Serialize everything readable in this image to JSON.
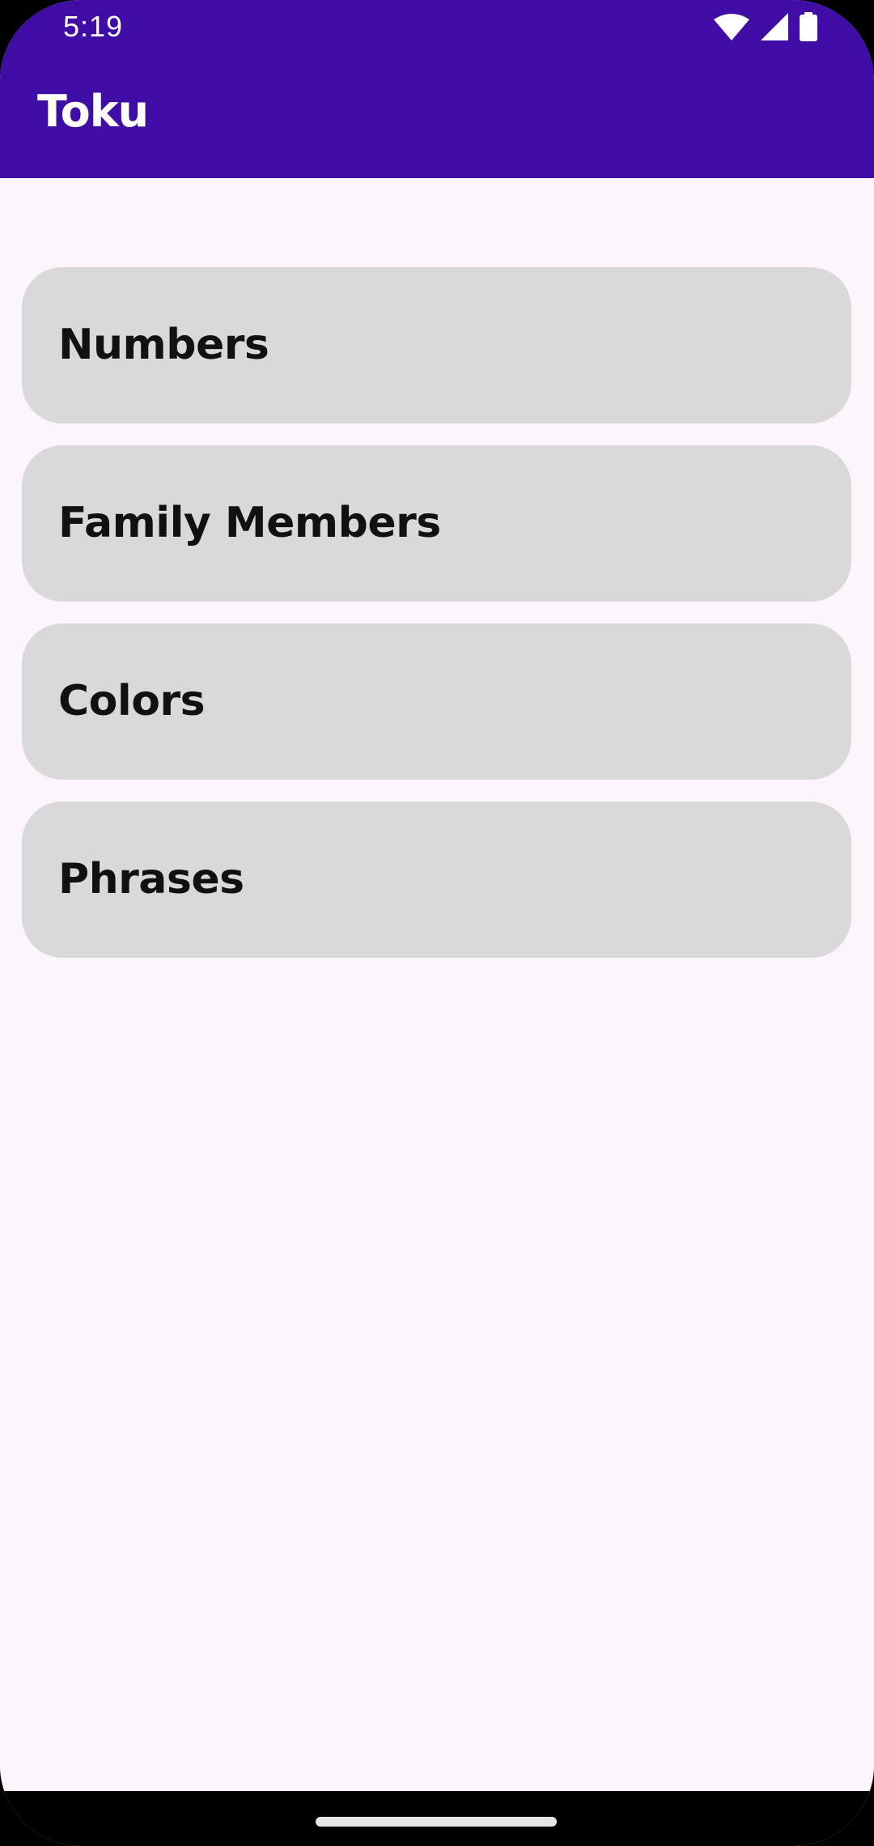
{
  "status_bar": {
    "time": "5:19",
    "icons": [
      "wifi-icon",
      "cellular-signal-icon",
      "battery-icon"
    ]
  },
  "app_bar": {
    "title": "Toku"
  },
  "categories": [
    {
      "label": "Numbers"
    },
    {
      "label": "Family Members"
    },
    {
      "label": "Colors"
    },
    {
      "label": "Phrases"
    }
  ],
  "colors": {
    "primary": "#3F0CA5",
    "background": "#FCF5FC",
    "card": "#D9D9D9",
    "text": "#111111"
  }
}
